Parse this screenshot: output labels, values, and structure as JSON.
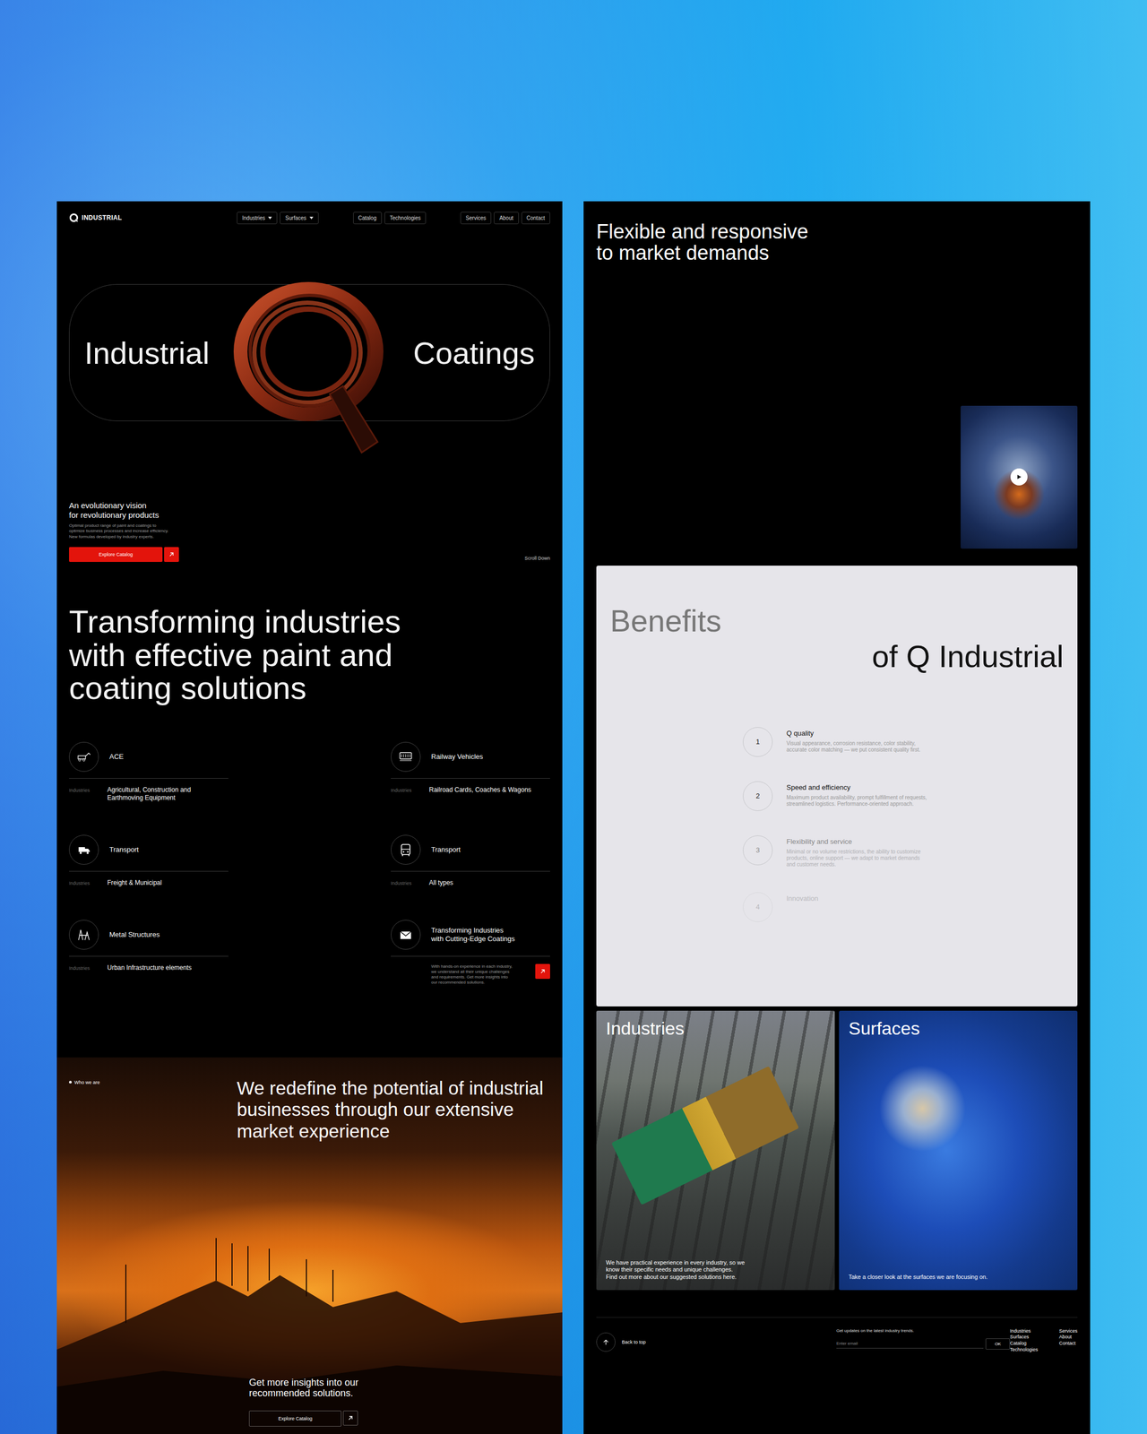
{
  "left": {
    "logo": "INDUSTRIAL",
    "nav": [
      [
        {
          "label": "Industries",
          "kind": "dropdown"
        },
        {
          "label": "Surfaces",
          "kind": "dropdown"
        }
      ],
      [
        {
          "label": "Catalog",
          "kind": "link"
        },
        {
          "label": "Technologies",
          "kind": "link"
        }
      ],
      [
        {
          "label": "Services",
          "kind": "link"
        },
        {
          "label": "About",
          "kind": "link"
        },
        {
          "label": "Contact",
          "kind": "link"
        }
      ]
    ],
    "hero": {
      "left": "Industrial",
      "right": "Coatings"
    },
    "intro": {
      "title": "An evolutionary vision\nfor revolutionary products",
      "text": "Optimal product range of paint and coatings to\noptimize business processes and increase efficiency.\nNew formulas developed by industry experts.",
      "button": "Explore Catalog",
      "scroll": "Scroll Down"
    },
    "heading": "Transforming industries\nwith effective paint and\ncoating solutions",
    "industries": [
      {
        "kind": "industry",
        "title": "ACE",
        "label": "Industries",
        "desc": "Agricultural, Construction and\nEarthmoving Equipment"
      },
      {
        "kind": "industry",
        "title": "Railway Vehicles",
        "label": "Industries",
        "desc": "Railroad Cards, Coaches & Wagons"
      },
      {
        "kind": "industry",
        "title": "Transport",
        "label": "Industries",
        "desc": "Freight & Municipal"
      },
      {
        "kind": "industry",
        "title": "Transport",
        "label": "Industries",
        "desc": "All types"
      },
      {
        "kind": "industry",
        "title": "Metal Structures",
        "label": "Industries",
        "desc": "Urban Infrastructure elements"
      },
      {
        "kind": "cta",
        "title": "Transforming Industries\nwith Cutting-Edge Coatings",
        "desc": "With hands-on experience in each industry,\nwe understand all their unique challenges\nand requirements. Get more insights into\nour recommended solutions."
      }
    ],
    "about": {
      "tag": "Who we are",
      "heading": "We redefine the potential of industrial\nbusinesses through our extensive\nmarket experience",
      "cta": "Get more insights into our\nrecommended solutions.",
      "button": "Explore Catalog"
    }
  },
  "right": {
    "heading": "Flexible and responsive\nto market demands",
    "benefits": {
      "title1": "Benefits",
      "title2": "of Q Industrial",
      "items": [
        {
          "number": "1",
          "title": "Q quality",
          "desc": "Visual appearance, corrosion resistance, color stability,\naccurate color matching — we put consistent quality first."
        },
        {
          "number": "2",
          "title": "Speed and efficiency",
          "desc": "Maximum product availability, prompt fulfillment of requests,\nstreamlined logistics. Performance-oriented approach."
        },
        {
          "number": "3",
          "title": "Flexibility and service",
          "desc": "Minimal or no volume restrictions, the ability to customize\nproducts, online support — we adapt to market demands\nand customer needs."
        },
        {
          "number": "4",
          "title": "Innovation"
        }
      ]
    },
    "cards": [
      {
        "kind": "train",
        "title": "Industries",
        "caption": "We have practical experience in every industry, so we\nknow their specific needs and unique challenges.\nFind out more about our suggested solutions here."
      },
      {
        "kind": "surf",
        "title": "Surfaces",
        "caption": "Take a closer look at the surfaces we are focusing on."
      }
    ],
    "footer": {
      "back": "Back to top",
      "newsletter": "Get updates on the latest industry trends.",
      "placeholder": "Enter email",
      "ok": "OK",
      "links": [
        [
          "Industries",
          "Surfaces",
          "Catalog",
          "Technologies"
        ],
        [
          "Services",
          "About",
          "Contact"
        ]
      ]
    }
  }
}
